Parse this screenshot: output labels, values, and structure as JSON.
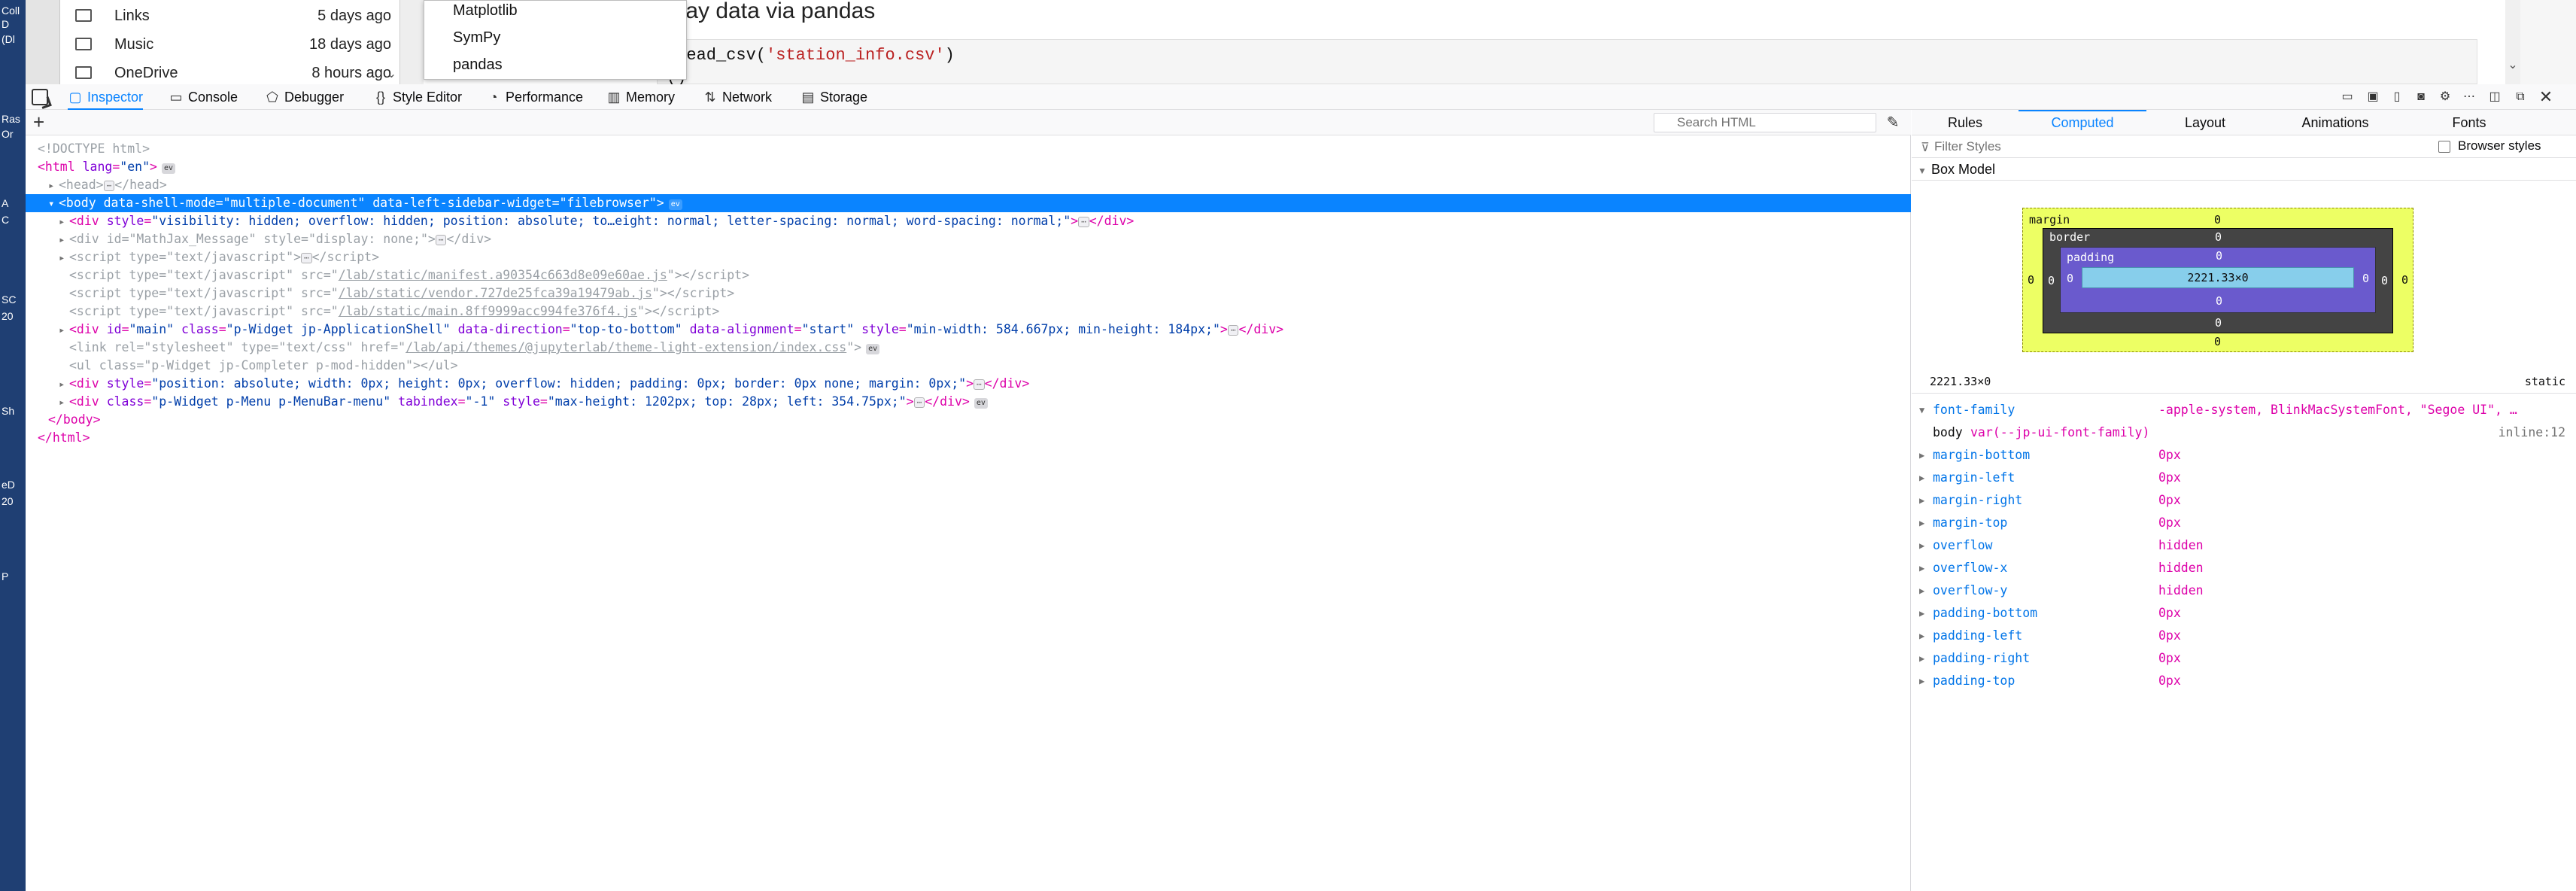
{
  "desktop": {
    "icons": [
      "Coll",
      "D",
      "(Dl",
      "Ras",
      "Or",
      "A",
      "C",
      "SC",
      "20",
      "Sh",
      "eD",
      "20",
      "P"
    ]
  },
  "file_browser": {
    "rows": [
      {
        "name": "Links",
        "modified": "5 days ago"
      },
      {
        "name": "Music",
        "modified": "18 days ago"
      },
      {
        "name": "OneDrive",
        "modified": "8 hours ago"
      }
    ]
  },
  "notebook": {
    "heading": "bway data via pandas",
    "code_prefix": ".read_csv(",
    "code_string": "'station_info.csv'",
    "code_suffix": ")",
    "code_line2": "()"
  },
  "completer": {
    "items": [
      "Matplotlib",
      "SymPy",
      "pandas"
    ]
  },
  "toolbar": {
    "tabs": [
      {
        "label": "Inspector",
        "icon": "inspector-icon"
      },
      {
        "label": "Console",
        "icon": "console-icon"
      },
      {
        "label": "Debugger",
        "icon": "debugger-icon"
      },
      {
        "label": "Style Editor",
        "icon": "style-editor-icon"
      },
      {
        "label": "Performance",
        "icon": "performance-icon"
      },
      {
        "label": "Memory",
        "icon": "memory-icon"
      },
      {
        "label": "Network",
        "icon": "network-icon"
      },
      {
        "label": "Storage",
        "icon": "storage-icon"
      }
    ],
    "active_tab": "Inspector"
  },
  "markup": {
    "search_placeholder": "Search HTML",
    "lines": {
      "doctype": "<!DOCTYPE html>",
      "html_open_tag": "<html",
      "html_lang_attr": "lang",
      "html_lang_val": "\"en\"",
      "head": "<head>",
      "head_close": "</head>",
      "body_tag": "<body",
      "body_attr1": "data-shell-mode",
      "body_val1": "\"multiple-document\"",
      "body_attr2": "data-left-sidebar-widget",
      "body_val2": "\"filebrowser\"",
      "div1_attr": "style",
      "div1_val": "\"visibility: hidden; overflow: hidden; position: absolute; to…eight: normal; letter-spacing: normal; word-spacing: normal;\"",
      "div2_attr1": "id",
      "div2_val1": "\"MathJax_Message\"",
      "div2_attr2": "style",
      "div2_val2": "\"display: none;\"",
      "script1_val": "\"text/javascript\"",
      "script2_src": "/lab/static/manifest.a90354c663d8e09e60ae.js",
      "script3_src": "/lab/static/vendor.727de25fca39a19479ab.js",
      "script4_src": "/lab/static/main.8ff9999acc994fe376f4.js",
      "main_id": "\"main\"",
      "main_class": "\"p-Widget jp-ApplicationShell\"",
      "main_dir": "\"top-to-bottom\"",
      "main_align": "\"start\"",
      "main_style": "\"min-width: 584.667px; min-height: 184px;\"",
      "link_rel": "\"stylesheet\"",
      "link_type": "\"text/css\"",
      "link_href": "/lab/api/themes/@jupyterlab/theme-light-extension/index.css",
      "ul_class": "\"p-Widget jp-Completer p-mod-hidden\"",
      "div3_style": "\"position: absolute; width: 0px; height: 0px; overflow: hidden; padding: 0px; border: 0px none; margin: 0px;\"",
      "div4_class": "\"p-Widget p-Menu p-MenuBar-menu\"",
      "div4_tabindex": "\"-1\"",
      "div4_style": "\"max-height: 1202px; top: 28px; left: 354.75px;\"",
      "body_close": "</body>",
      "html_close": "</html>",
      "event_badge": "ev"
    }
  },
  "sidebar": {
    "tabs": [
      "Rules",
      "Computed",
      "Layout",
      "Animations",
      "Fonts"
    ],
    "active_tab": "Computed",
    "filter_placeholder": "Filter Styles",
    "browser_styles_label": "Browser styles",
    "box_model_title": "Box Model",
    "box_model": {
      "margin_label": "margin",
      "border_label": "border",
      "padding_label": "padding",
      "margin": {
        "top": "0",
        "right": "0",
        "bottom": "0",
        "left": "0"
      },
      "border": {
        "top": "0",
        "right": "0",
        "bottom": "0",
        "left": "0"
      },
      "padding": {
        "top": "0",
        "right": "0",
        "bottom": "0",
        "left": "0"
      },
      "content": "2221.33×0",
      "dimensions": "2221.33×0",
      "position": "static"
    },
    "computed": {
      "font_family_name": "font-family",
      "font_family_value": "-apple-system, BlinkMacSystemFont, \"Segoe UI\", …",
      "font_rule_selector": "body",
      "font_rule_value": "var(--jp-ui-font-family)",
      "font_rule_source": "inline:12",
      "props": [
        {
          "name": "margin-bottom",
          "value": "0px"
        },
        {
          "name": "margin-left",
          "value": "0px"
        },
        {
          "name": "margin-right",
          "value": "0px"
        },
        {
          "name": "margin-top",
          "value": "0px"
        },
        {
          "name": "overflow",
          "value": "hidden"
        },
        {
          "name": "overflow-x",
          "value": "hidden"
        },
        {
          "name": "overflow-y",
          "value": "hidden"
        },
        {
          "name": "padding-bottom",
          "value": "0px"
        },
        {
          "name": "padding-left",
          "value": "0px"
        },
        {
          "name": "padding-right",
          "value": "0px"
        },
        {
          "name": "padding-top",
          "value": "0px"
        }
      ]
    }
  },
  "colors": {
    "accent": "#0a84ff",
    "tag": "#dd00a9",
    "attr_name": "#8000d7",
    "attr_value": "#003eaa",
    "prop_name": "#0074e8",
    "box_margin": "#edff64",
    "box_border": "#444444",
    "box_padding": "#6a5acd",
    "box_content": "#87ceeb"
  }
}
